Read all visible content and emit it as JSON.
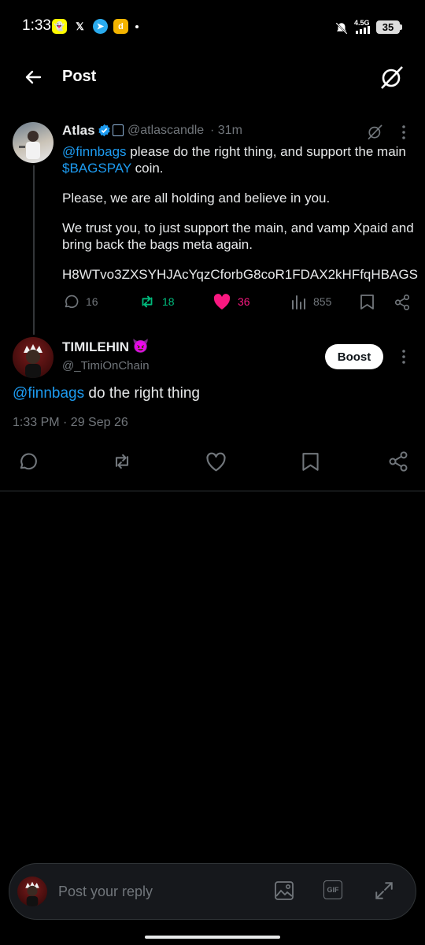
{
  "status_bar": {
    "time": "1:33",
    "network": "4.5G",
    "battery": "35"
  },
  "header": {
    "title": "Post"
  },
  "parent_post": {
    "author_name": "Atlas",
    "handle": "@atlascandle",
    "time_ago": "· 31m",
    "mention": "@finnbags",
    "text_line1_rest": " please do the right thing, and support the main",
    "ticker": "$BAGSPAY",
    "text_line2_rest": " coin.",
    "paragraph2": "Please, we are all holding and believe in you.",
    "paragraph3_line1": "We trust you, to just support the main, and vamp Xpaid and",
    "paragraph3_line2": "bring back the bags meta again.",
    "contract": "H8WTvo3ZXSYHJAcYqzCforbG8coR1FDAX2kHFfqHBAGS",
    "stats": {
      "replies": "16",
      "reposts": "18",
      "likes": "36",
      "views": "855"
    },
    "colors": {
      "repost": "#00ba7c",
      "like": "#f91880",
      "link": "#1d9bf0"
    }
  },
  "main_post": {
    "author_name": "TIMILEHIN",
    "emoji": "😈",
    "handle": "@_TimiOnChain",
    "boost_label": "Boost",
    "mention": "@finnbags",
    "text_rest": " do the right thing",
    "timestamp": "1:33 PM · 29 Sep 26"
  },
  "reply_bar": {
    "placeholder": "Post your reply"
  },
  "icons": [
    "back-arrow-icon",
    "grok-icon",
    "verified-icon",
    "more-icon",
    "reply-icon",
    "repost-icon",
    "like-icon",
    "views-icon",
    "bookmark-icon",
    "share-icon",
    "image-icon",
    "gif-icon",
    "expand-icon"
  ]
}
